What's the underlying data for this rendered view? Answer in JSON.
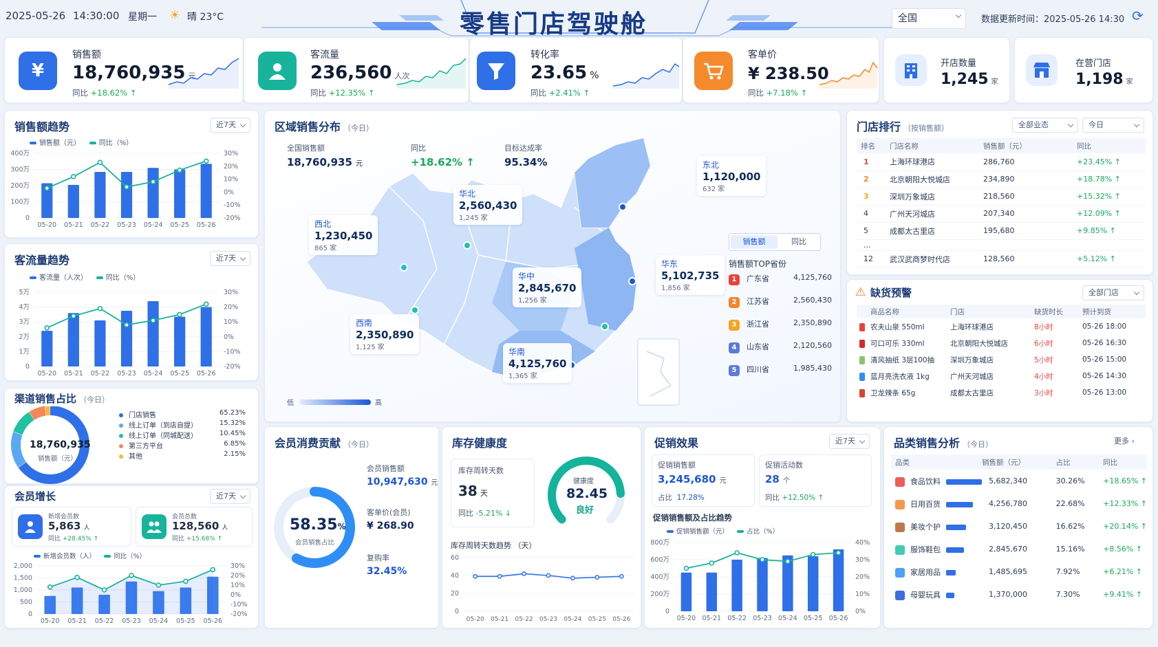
{
  "header": {
    "date": "2025-05-26",
    "time": "14:30:00",
    "weekday": "星期一",
    "weather": "晴 23°C",
    "title": "零售门店驾驶舱",
    "region": "全国",
    "updated": "数据更新时间：2025-05-26 14:30"
  },
  "kpis": [
    {
      "label": "销售额",
      "value": "18,760,935",
      "unit": "元",
      "yoy_label": "同比",
      "yoy": "+18.62%"
    },
    {
      "label": "客流量",
      "value": "236,560",
      "unit": "人次",
      "yoy_label": "同比",
      "yoy": "+12.35%"
    },
    {
      "label": "转化率",
      "value": "23.65",
      "unit": "%",
      "yoy_label": "同比",
      "yoy": "+2.41%"
    },
    {
      "label": "客单价",
      "value": "¥ 238.50",
      "unit": "",
      "yoy_label": "同比",
      "yoy": "+7.18%"
    }
  ],
  "stores": {
    "open": {
      "label": "开店数量",
      "value": "1,245",
      "unit": "家"
    },
    "active": {
      "label": "在营门店",
      "value": "1,198",
      "unit": "家"
    }
  },
  "dates": [
    "05-20",
    "05-21",
    "05-22",
    "05-23",
    "05-24",
    "05-25",
    "05-26"
  ],
  "sales_trend": {
    "title": "销售额趋势",
    "range": "近7天",
    "legend_bar": "销售额（元）",
    "legend_line": "同比（%）",
    "yticks": [
      "400万",
      "300万",
      "200万",
      "100万",
      "0"
    ],
    "y2ticks": [
      "30%",
      "20%",
      "10%",
      "0%",
      "-10%",
      "-20%"
    ]
  },
  "traffic_trend": {
    "title": "客流量趋势",
    "range": "近7天",
    "legend_bar": "客流量（人次）",
    "legend_line": "同比（%）",
    "yticks": [
      "5万",
      "4万",
      "3万",
      "2万",
      "1万",
      "0"
    ],
    "y2ticks": [
      "30%",
      "20%",
      "10%",
      "0%",
      "-10%",
      "-20%"
    ]
  },
  "channel": {
    "title": "渠道销售占比",
    "sub": "（今日）",
    "center_value": "18,760,935",
    "center_label": "销售额（元）",
    "items": [
      {
        "name": "门店销售",
        "pct": "65.23%",
        "color": "#2f6fe8"
      },
      {
        "name": "线上订单（到店自提）",
        "pct": "15.32%",
        "color": "#5aa8f5"
      },
      {
        "name": "线上订单（同城配送）",
        "pct": "10.45%",
        "color": "#20c2a2"
      },
      {
        "name": "第三方平台",
        "pct": "6.85%",
        "color": "#f5865a"
      },
      {
        "name": "其他",
        "pct": "2.15%",
        "color": "#f5b83d"
      }
    ]
  },
  "member_growth": {
    "title": "会员增长",
    "range": "近7天",
    "new_label": "新增会员数",
    "new_value": "5,863",
    "new_unit": "人",
    "new_yoy_label": "同比",
    "new_yoy": "+28.45%",
    "total_label": "会员总数",
    "total_value": "128,560",
    "total_unit": "人",
    "total_yoy_label": "同比",
    "total_yoy": "+15.68%",
    "legend_bar": "新增会员数（人）",
    "legend_line": "同比（%）",
    "yticks": [
      "2,000",
      "1,500",
      "1,000",
      "500",
      "0"
    ],
    "y2ticks": [
      "30%",
      "20%",
      "10%",
      "0%",
      "-10%",
      "-20%"
    ]
  },
  "region": {
    "title": "区域销售分布",
    "sub": "（今日）",
    "total_label": "全国销售额",
    "total_value": "18,760,935",
    "total_unit": "元",
    "yoy_label": "同比",
    "yoy": "+18.62%",
    "target_label": "目标达成率",
    "target": "95.34%",
    "areas": [
      {
        "name": "西北",
        "value": "1,230,450",
        "stores": "865 家"
      },
      {
        "name": "华北",
        "value": "2,560,430",
        "stores": "1,245 家"
      },
      {
        "name": "东北",
        "value": "1,120,000",
        "stores": "632 家"
      },
      {
        "name": "华东",
        "value": "5,102,735",
        "stores": "1,856 家"
      },
      {
        "name": "华中",
        "value": "2,845,670",
        "stores": "1,256 家"
      },
      {
        "name": "西南",
        "value": "2,350,890",
        "stores": "1,125 家"
      },
      {
        "name": "华南",
        "value": "4,125,760",
        "stores": "1,365 家"
      }
    ],
    "toggle": [
      "销售额",
      "同比"
    ],
    "top_title": "销售额TOP省份",
    "top": [
      {
        "rank": "1",
        "name": "广东省",
        "value": "4,125,760"
      },
      {
        "rank": "2",
        "name": "江苏省",
        "value": "2,560,430"
      },
      {
        "rank": "3",
        "name": "浙江省",
        "value": "2,350,890"
      },
      {
        "rank": "4",
        "name": "山东省",
        "value": "2,120,560"
      },
      {
        "rank": "5",
        "name": "四川省",
        "value": "1,985,430"
      }
    ],
    "scale_low": "低",
    "scale_high": "高"
  },
  "ranking": {
    "title": "门店排行",
    "sub": "（按销售额）",
    "filter1": "全部业态",
    "filter2": "今日",
    "headers": [
      "排名",
      "门店名称",
      "销售额（元）",
      "同比"
    ],
    "rows": [
      {
        "rank": "1",
        "name": "上海环球港店",
        "sales": "286,760",
        "yoy": "+23.45%"
      },
      {
        "rank": "2",
        "name": "北京朝阳大悦城店",
        "sales": "234,890",
        "yoy": "+18.78%"
      },
      {
        "rank": "3",
        "name": "深圳万象城店",
        "sales": "218,560",
        "yoy": "+15.32%"
      },
      {
        "rank": "4",
        "name": "广州天河城店",
        "sales": "207,340",
        "yoy": "+12.09%"
      },
      {
        "rank": "5",
        "name": "成都太古里店",
        "sales": "195,680",
        "yoy": "+9.85%"
      },
      {
        "rank": "...",
        "name": "",
        "sales": "",
        "yoy": ""
      },
      {
        "rank": "12",
        "name": "武汉武商梦时代店",
        "sales": "128,560",
        "yoy": "+5.12%"
      }
    ]
  },
  "stockout": {
    "title": "缺货预警",
    "filter": "全部门店",
    "headers": [
      "商品名称",
      "门店",
      "缺货时长",
      "预计到货"
    ],
    "rows": [
      {
        "item": "农夫山泉 550ml",
        "store": "上海环球港店",
        "dur": "8小时",
        "eta": "05-26 18:00"
      },
      {
        "item": "可口可乐 330ml",
        "store": "北京朝阳大悦城店",
        "dur": "6小时",
        "eta": "05-26 16:30"
      },
      {
        "item": "清风抽纸 3层100抽",
        "store": "深圳万象城店",
        "dur": "5小时",
        "eta": "05-26 15:00"
      },
      {
        "item": "蓝月亮洗衣液 1kg",
        "store": "广州天河城店",
        "dur": "4小时",
        "eta": "05-26 14:30"
      },
      {
        "item": "卫龙辣条 65g",
        "store": "成都太古里店",
        "dur": "3小时",
        "eta": "05-26 13:00"
      }
    ]
  },
  "member_contrib": {
    "title": "会员消费贡献",
    "sub": "（今日）",
    "pct": "58.35",
    "pct_unit": "%",
    "pct_label": "会员销售占比",
    "sales_label": "会员销售额",
    "sales_value": "10,947,630",
    "sales_unit": "元",
    "aov_label": "客单价(会员)",
    "aov_value": "¥ 268.90",
    "repurchase_label": "复购率",
    "repurchase_value": "32.45%"
  },
  "inventory": {
    "title": "库存健康度",
    "turn_label": "库存周转天数",
    "turn_value": "38",
    "turn_unit": "天",
    "yoy_label": "同比",
    "yoy": "-5.21%",
    "health_label": "健康度",
    "health_value": "82.45",
    "health_status": "良好",
    "trend_title": "库存周转天数趋势 （天）",
    "yticks": [
      "60",
      "40",
      "20",
      "0"
    ]
  },
  "promo": {
    "title": "促销效果",
    "range": "近7天",
    "sales_label": "促销销售额",
    "sales_value": "3,245,680",
    "sales_unit": "元",
    "share_label": "占比",
    "share": "17.28%",
    "count_label": "促销活动数",
    "count_value": "28",
    "count_unit": "个",
    "yoy_label": "同比",
    "yoy": "+12.50%",
    "chart_title": "促销销售额及占比趋势",
    "legend_bar": "促销销售额（元）",
    "legend_line": "占比（%）",
    "yticks": [
      "800万",
      "600万",
      "400万",
      "200万",
      "0"
    ],
    "y2ticks": [
      "40%",
      "30%",
      "20%",
      "10%",
      "0%"
    ]
  },
  "category": {
    "title": "品类销售分析",
    "sub": "（今日）",
    "more": "更多",
    "headers": [
      "品类",
      "销售额（元）",
      "占比",
      "同比"
    ],
    "rows": [
      {
        "name": "食品饮料",
        "sales": "5,682,340",
        "share": "30.26%",
        "yoy": "+18.65%",
        "ratio": 1.0
      },
      {
        "name": "日用百货",
        "sales": "4,256,780",
        "share": "22.68%",
        "yoy": "+12.33%",
        "ratio": 0.75
      },
      {
        "name": "美妆个护",
        "sales": "3,120,450",
        "share": "16.62%",
        "yoy": "+20.14%",
        "ratio": 0.55
      },
      {
        "name": "服饰鞋包",
        "sales": "2,845,670",
        "share": "15.16%",
        "yoy": "+8.56%",
        "ratio": 0.5
      },
      {
        "name": "家居用品",
        "sales": "1,485,695",
        "share": "7.92%",
        "yoy": "+6.21%",
        "ratio": 0.27
      },
      {
        "name": "母婴玩具",
        "sales": "1,370,000",
        "share": "7.30%",
        "yoy": "+9.41%",
        "ratio": 0.24
      }
    ]
  },
  "chart_data": [
    {
      "type": "bar",
      "name": "sales_trend",
      "title": "销售额趋势",
      "categories": [
        "05-20",
        "05-21",
        "05-22",
        "05-23",
        "05-24",
        "05-25",
        "05-26"
      ],
      "series": [
        {
          "name": "销售额（元）",
          "values": [
            2150000,
            2050000,
            2850000,
            2850000,
            3100000,
            3000000,
            3350000
          ],
          "ylim": [
            0,
            4000000
          ]
        },
        {
          "name": "同比（%）",
          "type": "line",
          "values": [
            3,
            12,
            23,
            4,
            8,
            17,
            24
          ],
          "ylim": [
            -20,
            30
          ]
        }
      ]
    },
    {
      "type": "bar",
      "name": "traffic_trend",
      "title": "客流量趋势",
      "categories": [
        "05-20",
        "05-21",
        "05-22",
        "05-23",
        "05-24",
        "05-25",
        "05-26"
      ],
      "series": [
        {
          "name": "客流量（人次）",
          "values": [
            24000,
            36000,
            31000,
            37500,
            44000,
            33500,
            40000
          ],
          "ylim": [
            0,
            50000
          ]
        },
        {
          "name": "同比（%）",
          "type": "line",
          "values": [
            6,
            14,
            19,
            8,
            11,
            15,
            22
          ],
          "ylim": [
            -20,
            30
          ]
        }
      ]
    },
    {
      "type": "pie",
      "name": "channel",
      "categories": [
        "门店销售",
        "线上订单（到店自提）",
        "线上订单（同城配送）",
        "第三方平台",
        "其他"
      ],
      "values": [
        65.23,
        15.32,
        10.45,
        6.85,
        2.15
      ]
    },
    {
      "type": "bar",
      "name": "member_growth",
      "categories": [
        "05-20",
        "05-21",
        "05-22",
        "05-23",
        "05-24",
        "05-25",
        "05-26"
      ],
      "series": [
        {
          "name": "新增会员数（人）",
          "values": [
            750,
            1100,
            800,
            1350,
            950,
            1100,
            1550
          ],
          "ylim": [
            0,
            2000
          ]
        },
        {
          "name": "同比（%）",
          "type": "line",
          "values": [
            8,
            18,
            5,
            20,
            10,
            14,
            26
          ],
          "ylim": [
            -20,
            30
          ]
        }
      ]
    },
    {
      "type": "pie",
      "name": "member_contrib",
      "categories": [
        "会员销售占比"
      ],
      "values": [
        58.35
      ]
    },
    {
      "type": "pie",
      "name": "inventory_health",
      "categories": [
        "健康度"
      ],
      "values": [
        82.45
      ]
    },
    {
      "type": "line",
      "name": "inventory_turnover",
      "title": "库存周转天数趋势 （天）",
      "categories": [
        "05-20",
        "05-21",
        "05-22",
        "05-23",
        "05-24",
        "05-25",
        "05-26"
      ],
      "series": [
        {
          "name": "库存周转天数",
          "values": [
            39,
            39,
            42,
            40,
            37,
            38,
            39
          ],
          "ylim": [
            0,
            60
          ]
        }
      ]
    },
    {
      "type": "bar",
      "name": "promo_trend",
      "title": "促销销售额及占比趋势",
      "categories": [
        "05-20",
        "05-21",
        "05-22",
        "05-23",
        "05-24",
        "05-25",
        "05-26"
      ],
      "series": [
        {
          "name": "促销销售额（元）",
          "values": [
            4500000,
            4500000,
            6000000,
            6200000,
            6500000,
            6400000,
            7200000
          ],
          "ylim": [
            0,
            8000000
          ]
        },
        {
          "name": "占比（%）",
          "type": "line",
          "values": [
            25,
            28,
            34,
            30,
            29,
            33,
            34
          ],
          "ylim": [
            0,
            40
          ]
        }
      ]
    }
  ]
}
